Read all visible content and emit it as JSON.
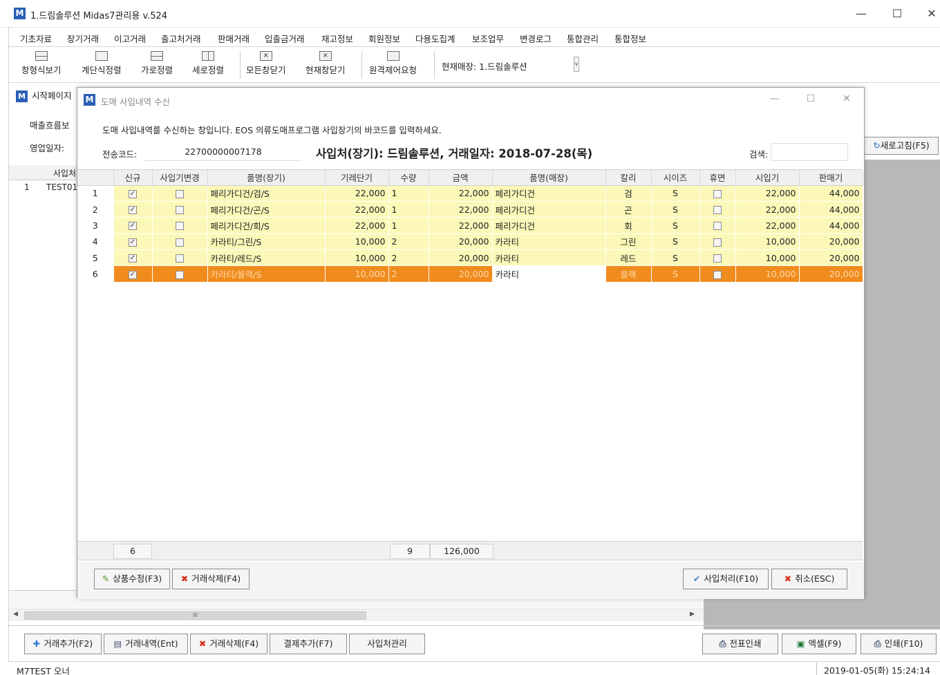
{
  "window": {
    "logo": "M",
    "title": "1.드림솔루션 Midas7관리용 v.524",
    "minimize": "—",
    "maximize": "☐",
    "close": "✕"
  },
  "menu": [
    "기초자료",
    "장기거래",
    "이고거래",
    "출고처거래",
    "판매거래",
    "입출금거래",
    "재고정보",
    "회원정보",
    "다용도집계",
    "보조업무",
    "변경로그",
    "통합관리",
    "통합정보"
  ],
  "toolbar": {
    "buttons": [
      "창형식보기",
      "계단식정렬",
      "가로정렬",
      "세로정렬",
      "모든창닫기",
      "현재창닫기",
      "원격제어요청"
    ],
    "store_label": "현재매장:  1.드림솔루션",
    "store_arrow": "∨"
  },
  "background": {
    "tab_logo": "M",
    "tab_label": "시작페이지",
    "label_sales": "매출흐름보",
    "label_date": "영업일자:",
    "grid_header": "사입처",
    "row_num": "1",
    "row_text": "TEST01",
    "refresh_button": "새로고침(F5)",
    "scroll_mark": "III"
  },
  "dialog": {
    "logo": "M",
    "title": "도매 사입내역 수신",
    "minimize": "—",
    "maximize": "☐",
    "close": "✕",
    "description": "도매 사입내역를 수신하는 창입니다. EOS 의류도매프로그램 사입장기의 바코드를 입력하세요.",
    "code_label": "전송코드:",
    "code_value": "22700000007178",
    "headline": "사입처(장기): 드림솔루션, 거래일자: 2018-07-28(목)",
    "search_label": "검색:",
    "columns": [
      "신규",
      "사입기변경",
      "품명(장기)",
      "기레단기",
      "수량",
      "금액",
      "품명(매장)",
      "칼리",
      "시이즈",
      "휴면",
      "시입기",
      "판매기"
    ],
    "rows": [
      {
        "no": "1",
        "name_ledger": "페리가디건/검/S",
        "unit": "22,000",
        "qty": "1",
        "amount": "22,000",
        "name_store": "페리가디건",
        "color": "검",
        "size": "S",
        "buy": "22,000",
        "sell": "44,000"
      },
      {
        "no": "2",
        "name_ledger": "페리가디건/곤/S",
        "unit": "22,000",
        "qty": "1",
        "amount": "22,000",
        "name_store": "페리가디건",
        "color": "곤",
        "size": "S",
        "buy": "22,000",
        "sell": "44,000"
      },
      {
        "no": "3",
        "name_ledger": "페리가디건/회/S",
        "unit": "22,000",
        "qty": "1",
        "amount": "22,000",
        "name_store": "페리가디건",
        "color": "회",
        "size": "S",
        "buy": "22,000",
        "sell": "44,000"
      },
      {
        "no": "4",
        "name_ledger": "카라티/그린/S",
        "unit": "10,000",
        "qty": "2",
        "amount": "20,000",
        "name_store": "카라티",
        "color": "그린",
        "size": "S",
        "buy": "10,000",
        "sell": "20,000"
      },
      {
        "no": "5",
        "name_ledger": "카라티/레드/S",
        "unit": "10,000",
        "qty": "2",
        "amount": "20,000",
        "name_store": "카라티",
        "color": "레드",
        "size": "S",
        "buy": "10,000",
        "sell": "20,000"
      },
      {
        "no": "6",
        "name_ledger": "카라티/블랙/S",
        "unit": "10,000",
        "qty": "2",
        "amount": "20,000",
        "name_store": "카라티",
        "color": "블랙",
        "size": "S",
        "buy": "10,000",
        "sell": "20,000"
      }
    ],
    "totals": {
      "count": "6",
      "qty": "9",
      "amount": "126,000"
    },
    "buttons": {
      "edit": "상품수정(F3)",
      "delete": "거래삭제(F4)",
      "process": "사입처리(F10)",
      "cancel": "취소(ESC)"
    }
  },
  "bottom_buttons": {
    "add": "거래추가(F2)",
    "history": "거래내역(Ent)",
    "delete": "거래삭제(F4)",
    "payment": "결제추가(F7)",
    "supplier": "사입처관리",
    "slip_print": "전표인쇄",
    "excel": "엑셀(F9)",
    "print": "인쇄(F10)"
  },
  "status": {
    "user": "M7TEST  오너",
    "datetime": "2019-01-05(화) 15:24:14"
  },
  "colors": {
    "row_highlight": "#fbf8b8",
    "row_selected": "#f08c1e",
    "brand": "#2a5fb5"
  }
}
